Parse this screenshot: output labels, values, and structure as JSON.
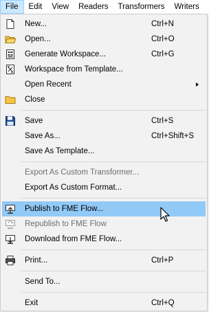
{
  "menubar": {
    "items": [
      {
        "label": "File"
      },
      {
        "label": "Edit"
      },
      {
        "label": "View"
      },
      {
        "label": "Readers"
      },
      {
        "label": "Transformers"
      },
      {
        "label": "Writers"
      }
    ]
  },
  "menu": {
    "items": [
      {
        "label": "New...",
        "shortcut": "Ctrl+N",
        "icon": "new-file-icon"
      },
      {
        "label": "Open...",
        "shortcut": "Ctrl+O",
        "icon": "open-folder-icon"
      },
      {
        "label": "Generate Workspace...",
        "shortcut": "Ctrl+G",
        "icon": "generate-workspace-icon"
      },
      {
        "label": "Workspace from Template...",
        "shortcut": "",
        "icon": "template-icon"
      },
      {
        "label": "Open Recent",
        "shortcut": "",
        "submenu": true
      },
      {
        "label": "Close",
        "shortcut": "",
        "icon": "close-folder-icon"
      },
      {
        "label": "Save",
        "shortcut": "Ctrl+S",
        "icon": "save-icon"
      },
      {
        "label": "Save As...",
        "shortcut": "Ctrl+Shift+S"
      },
      {
        "label": "Save As Template...",
        "shortcut": ""
      },
      {
        "label": "Export As Custom Transformer...",
        "shortcut": "",
        "disabled": true
      },
      {
        "label": "Export As Custom Format...",
        "shortcut": ""
      },
      {
        "label": "Publish to FME Flow...",
        "shortcut": "",
        "icon": "publish-icon",
        "highlighted": true
      },
      {
        "label": "Republish to FME Flow",
        "shortcut": "",
        "icon": "republish-icon",
        "disabled": true
      },
      {
        "label": "Download from FME Flow...",
        "shortcut": "",
        "icon": "download-icon"
      },
      {
        "label": "Print...",
        "shortcut": "Ctrl+P",
        "icon": "print-icon"
      },
      {
        "label": "Send To...",
        "shortcut": ""
      },
      {
        "label": "Exit",
        "shortcut": "Ctrl+Q"
      }
    ]
  },
  "colors": {
    "highlight": "#91c9f7",
    "menu_background": "#f2f2f2",
    "active_menubar": "#cce8ff",
    "disabled_text": "#6d6d6d"
  }
}
